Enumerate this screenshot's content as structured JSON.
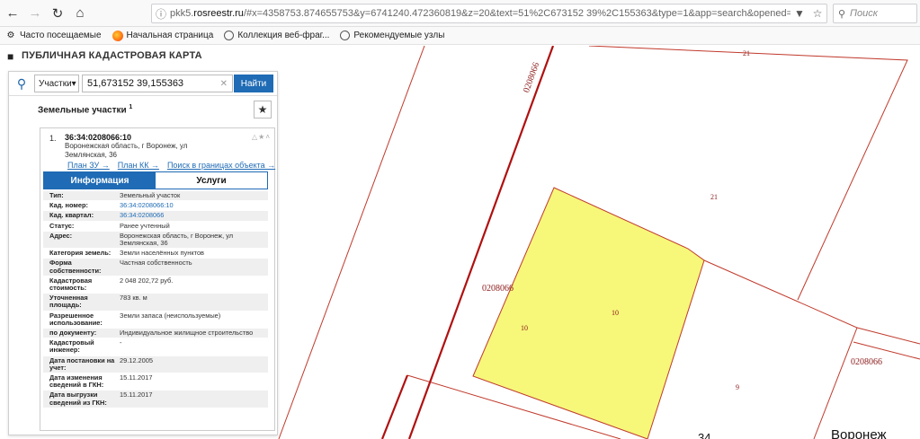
{
  "browser": {
    "url_prefix": "pkk5.",
    "url_domain": "rosreestr.ru",
    "url_rest": "/#x=4358753.874655753&y=6741240.472360819&z=20&text=51%2C673152 39%2C155363&type=1&app=search&opened=1",
    "search_placeholder": "Поиск",
    "bookmarks": [
      "Часто посещаемые",
      "Начальная страница",
      "Коллекция веб-фраг...",
      "Рекомендуемые узлы"
    ]
  },
  "app": {
    "title": "ПУБЛИЧНАЯ КАДАСТРОВАЯ КАРТА"
  },
  "search": {
    "type_label": "Участки",
    "query": "51,673152 39,155363",
    "button": "Найти"
  },
  "section": {
    "title": "Земельные участки",
    "count_sup": "1"
  },
  "result": {
    "number": "1.",
    "cad_id": "36:34:0208066:10",
    "address": "Воронежская область, г Воронеж, ул Землянская, 36",
    "links": [
      "План ЗУ →",
      "План КК →",
      "Поиск в границах объекта →"
    ],
    "tabs": [
      "Информация",
      "Услуги"
    ],
    "fields": [
      {
        "k": "Тип:",
        "v": "Земельный участок"
      },
      {
        "k": "Кад. номер:",
        "v": "36:34:0208066:10"
      },
      {
        "k": "Кад. квартал:",
        "v": "36:34:0208066"
      },
      {
        "k": "Статус:",
        "v": "Ранее учтенный"
      },
      {
        "k": "Адрес:",
        "v": "Воронежская область, г Воронеж, ул Землянская, 36"
      },
      {
        "k": "Категория земель:",
        "v": "Земли населённых пунктов"
      },
      {
        "k": "Форма собственности:",
        "v": "Частная собственность"
      },
      {
        "k": "Кадастровая стоимость:",
        "v": "2 048 202,72 руб."
      },
      {
        "k": "Уточненная площадь:",
        "v": "783 кв. м"
      },
      {
        "k": "Разрешенное использование:",
        "v": "Земли запаса (неиспользуемые)"
      },
      {
        "k": "по документу:",
        "v": "Индивидуальное жилищное строительство"
      },
      {
        "k": "Кадастровый инженер:",
        "v": "-"
      },
      {
        "k": "Дата постановки на учет:",
        "v": "29.12.2005"
      },
      {
        "k": "Дата изменения сведений в ГКН:",
        "v": "15.11.2017"
      },
      {
        "k": "Дата выгрузки сведений из ГКН:",
        "v": "15.11.2017"
      }
    ]
  },
  "map_labels": {
    "l21a": "21",
    "l21b": "21",
    "block_vertical": "0208066",
    "block_left": "0208066",
    "block_right": "0208066",
    "p10a": "10",
    "p10b": "10",
    "p9": "9",
    "p34": "34",
    "street": "Воронеж"
  },
  "colors": {
    "parcel_fill": "#f7f77a",
    "boundary": "#c0392b",
    "accent": "#1f6bb5"
  }
}
